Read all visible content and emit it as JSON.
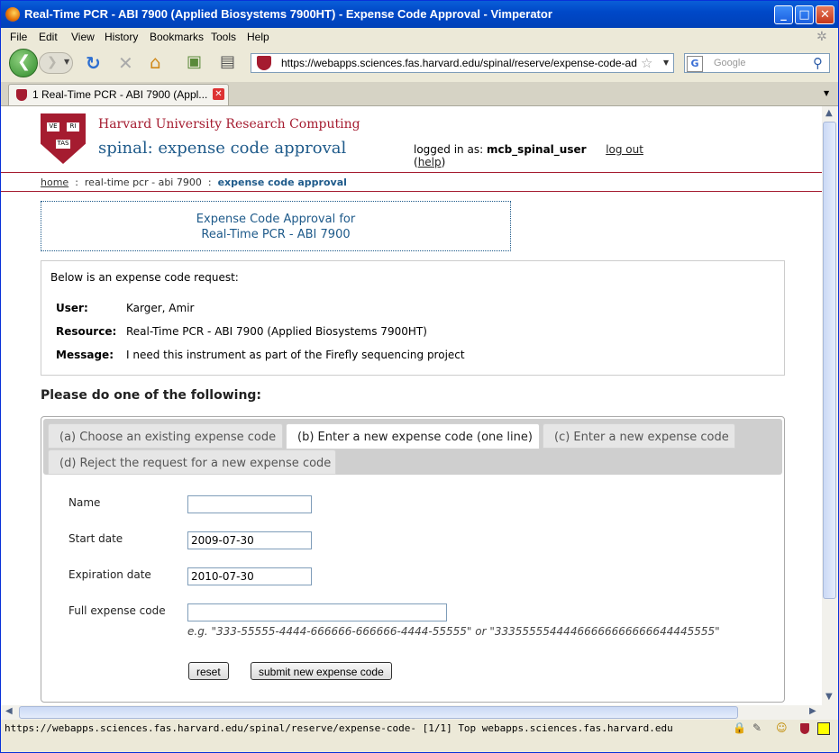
{
  "window": {
    "title": "Real-Time PCR - ABI 7900 (Applied Biosystems 7900HT) - Expense Code Approval - Vimperator"
  },
  "menu": [
    "File",
    "Edit",
    "View",
    "History",
    "Bookmarks",
    "Tools",
    "Help"
  ],
  "nav": {
    "url": "https://webapps.sciences.fas.harvard.edu/spinal/reserve/expense-code-admin-e",
    "search_placeholder": "Google"
  },
  "tab": {
    "label": "1 Real-Time PCR - ABI 7900 (Appl..."
  },
  "header": {
    "org": "Harvard University Research Computing",
    "app": "spinal: expense code approval",
    "logged_in_prefix": "logged in as:",
    "user": "mcb_spinal_user",
    "logout": "log out",
    "help_open": "(",
    "help": "help",
    "help_close": ")",
    "crest_text": [
      "VE",
      "RI",
      "TAS"
    ]
  },
  "breadcrumb": {
    "home": "home",
    "sep1": ":",
    "resource": "real-time pcr - abi 7900",
    "sep2": ":",
    "current": "expense code approval"
  },
  "title_box": {
    "line1": "Expense Code Approval for",
    "line2": "Real-Time PCR - ABI 7900"
  },
  "request": {
    "lead": "Below is an expense code request:",
    "user_label": "User:",
    "user": "Karger, Amir",
    "resource_label": "Resource:",
    "resource": "Real-Time PCR - ABI 7900 (Applied Biosystems 7900HT)",
    "message_label": "Message:",
    "message": "I need this instrument as part of the Firefly sequencing project"
  },
  "instructions": "Please do one of the following:",
  "options": {
    "a": "(a) Choose an existing expense code",
    "b": "(b) Enter a new expense code (one line)",
    "c": "(c) Enter a new expense code",
    "d": "(d) Reject the request for a new expense code"
  },
  "form": {
    "name_label": "Name",
    "name_value": "",
    "start_label": "Start date",
    "start_value": "2009-07-30",
    "expiration_label": "Expiration date",
    "expiration_value": "2010-07-30",
    "full_label": "Full expense code",
    "full_value": "",
    "hint": "e.g. \"333-55555-4444-666666-666666-4444-55555\" or \"33355555444466666666666644445555\"",
    "reset": "reset",
    "submit": "submit new expense code"
  },
  "status": {
    "text": "https://webapps.sciences.fas.harvard.edu/spinal/reserve/expense-code-   [1/1] Top webapps.sciences.fas.harvard.edu"
  },
  "colors": {
    "crimson": "#a51c30",
    "link_blue": "#1e5a8a",
    "xp_blue": "#0a5fd8"
  }
}
